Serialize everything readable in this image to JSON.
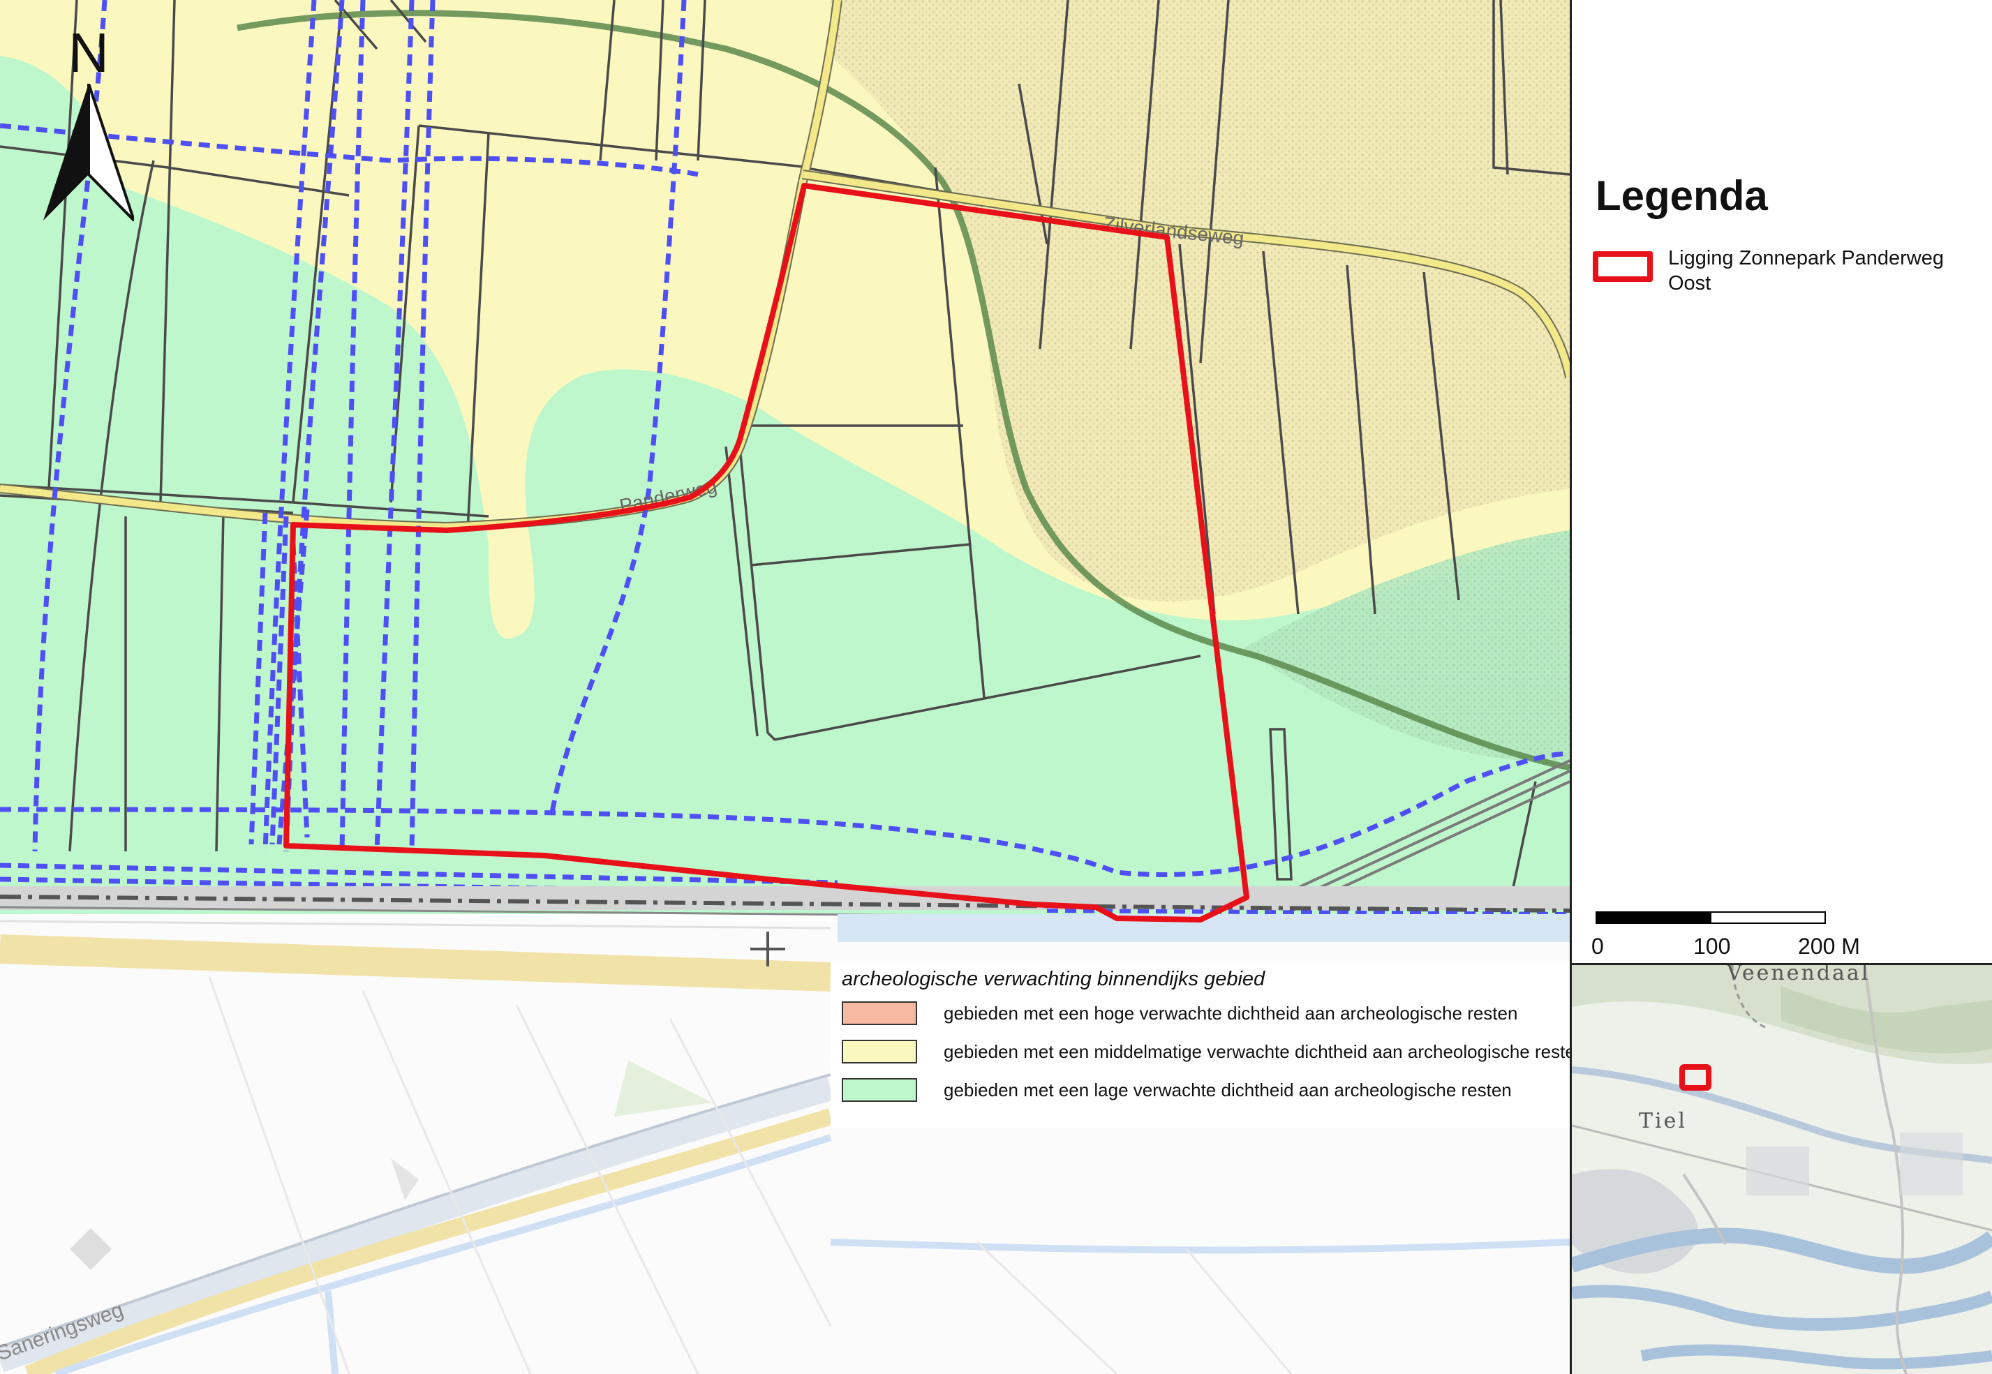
{
  "map": {
    "street_labels": [
      {
        "text": "Zilverlandseweg",
        "id": "zilverlandseweg"
      },
      {
        "text": "Panderweg",
        "id": "panderweg"
      },
      {
        "text": "Saneringsweg",
        "id": "saneringsweg"
      }
    ],
    "north_label": "N",
    "icons": [
      "north-arrow-icon",
      "crosshair-icon"
    ],
    "colors": {
      "low_expectation": "#bff7cc",
      "medium_expectation": "#fbf8bf",
      "high_expectation": "#f8b9a2",
      "site_boundary": "#e8111a",
      "ditch_dashed": "#4e4ff5",
      "parcel_lines": "#4a4a4a",
      "contour_line": "#5c8a4e"
    }
  },
  "arch_legend": {
    "title": "archeologische verwachting binnendijks gebied",
    "items": [
      {
        "label": "gebieden met een hoge verwachte dichtheid aan archeologische resten",
        "color": "#f8b9a2"
      },
      {
        "label": "gebieden met een middelmatige verwachte dichtheid aan archeologische resten",
        "color": "#fbf8bf"
      },
      {
        "label": "gebieden met een lage verwachte dichtheid aan archeologische resten",
        "color": "#bff7cc"
      }
    ]
  },
  "legend": {
    "title": "Legenda",
    "site_label": "Ligging Zonnepark Panderweg Oost",
    "site_color": "#e8111a"
  },
  "scalebar": {
    "labels": [
      "0",
      "100",
      "200 M"
    ]
  },
  "overview": {
    "places": [
      "Veenendaal",
      "Tiel"
    ],
    "marker_color": "#e8111a"
  }
}
